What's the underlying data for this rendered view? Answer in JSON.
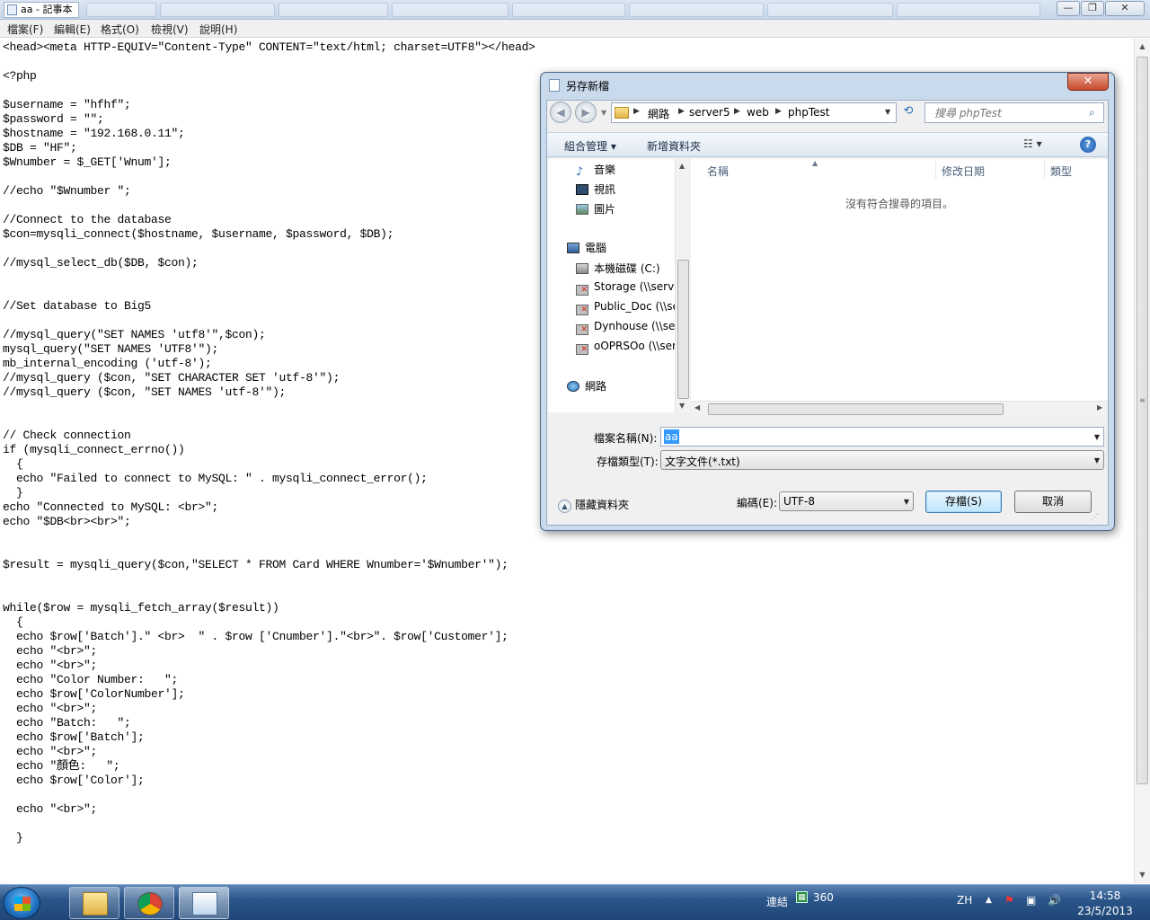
{
  "notepad": {
    "title": "aa - 記事本",
    "menu": [
      "檔案(F)",
      "編輯(E)",
      "格式(O)",
      "檢視(V)",
      "說明(H)"
    ],
    "code_lines": [
      "<head><meta HTTP-EQUIV=\"Content-Type\" CONTENT=\"text/html; charset=UTF8\"></head>",
      "",
      "<?php",
      "",
      "$username = \"hfhf\";",
      "$password = \"\";",
      "$hostname = \"192.168.0.11\";",
      "$DB = \"HF\";",
      "$Wnumber = $_GET['Wnum'];",
      "",
      "//echo \"$Wnumber \";",
      "",
      "//Connect to the database",
      "$con=mysqli_connect($hostname, $username, $password, $DB);",
      "",
      "//mysql_select_db($DB, $con);",
      "",
      "",
      "//Set database to Big5",
      "",
      "//mysql_query(\"SET NAMES 'utf8'\",$con);",
      "mysql_query(\"SET NAMES 'UTF8'\");",
      "mb_internal_encoding ('utf-8');",
      "//mysql_query ($con, \"SET CHARACTER SET 'utf-8'\");",
      "//mysql_query ($con, \"SET NAMES 'utf-8'\");",
      "",
      "",
      "// Check connection",
      "if (mysqli_connect_errno())",
      "  {",
      "  echo \"Failed to connect to MySQL: \" . mysqli_connect_error();",
      "  }",
      "echo \"Connected to MySQL: <br>\";",
      "echo \"$DB<br><br>\";",
      "",
      "",
      "$result = mysqli_query($con,\"SELECT * FROM Card WHERE Wnumber='$Wnumber'\");",
      "",
      "",
      "while($row = mysqli_fetch_array($result))",
      "  {",
      "  echo $row['Batch'].\" <br>  \" . $row ['Cnumber'].\"<br>\". $row['Customer'];",
      "  echo \"<br>\";",
      "  echo \"<br>\";",
      "  echo \"Color Number:   \";",
      "  echo $row['ColorNumber'];",
      "  echo \"<br>\";",
      "  echo \"Batch:   \";",
      "  echo $row['Batch'];",
      "  echo \"<br>\";",
      "  echo \"顏色:   \";",
      "  echo $row['Color'];",
      "",
      "  echo \"<br>\";",
      "",
      "  }"
    ]
  },
  "dialog": {
    "title": "另存新檔",
    "address": [
      "網路",
      "server5",
      "web",
      "phpTest"
    ],
    "search_placeholder": "搜尋 phpTest",
    "toolbar": {
      "organize": "組合管理 ▾",
      "new_folder": "新增資料夾"
    },
    "nav_items": [
      {
        "label": "音樂",
        "icon": "music-icon"
      },
      {
        "label": "視訊",
        "icon": "video-icon"
      },
      {
        "label": "圖片",
        "icon": "pictures-icon"
      },
      {
        "label": "電腦",
        "icon": "computer-icon"
      },
      {
        "label": "本機磁碟 (C:)",
        "icon": "local-disk-icon"
      },
      {
        "label": "Storage (\\\\serve",
        "icon": "network-drive-icon"
      },
      {
        "label": "Public_Doc (\\\\se",
        "icon": "network-drive-icon"
      },
      {
        "label": "Dynhouse (\\\\ser",
        "icon": "network-drive-icon"
      },
      {
        "label": "oOPRSOo (\\\\ser",
        "icon": "network-drive-icon"
      },
      {
        "label": "網路",
        "icon": "network-icon"
      }
    ],
    "columns": [
      "名稱",
      "修改日期",
      "類型"
    ],
    "empty_message": "沒有符合搜尋的項目。",
    "filename_label": "檔案名稱(N):",
    "filename_value": "aa",
    "filetype_label": "存檔類型(T):",
    "filetype_value": "文字文件(*.txt)",
    "hide_folders": "隱藏資料夾",
    "encoding_label": "編碼(E):",
    "encoding_value": "UTF-8",
    "save_button": "存檔(S)",
    "cancel_button": "取消"
  },
  "taskbar": {
    "tray_connect": "連結",
    "tray_360": "360",
    "lang": "ZH",
    "time": "14:58",
    "date": "23/5/2013"
  }
}
